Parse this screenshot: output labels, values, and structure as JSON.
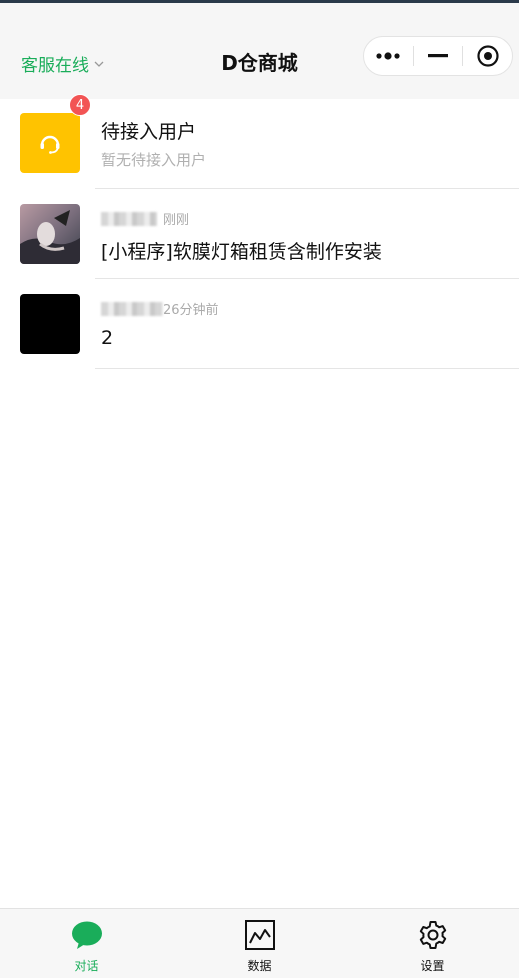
{
  "header": {
    "status_label": "客服在线",
    "title": "D仓商城"
  },
  "capsule": {
    "more_icon": "more-dots-icon",
    "minimize_icon": "minimize-icon",
    "close_icon": "target-close-icon"
  },
  "pending": {
    "title": "待接入用户",
    "subtitle": "暂无待接入用户",
    "icon": "headset-icon",
    "color": "#ffc300"
  },
  "conversations": [
    {
      "time": "刚刚",
      "message": "[小程序]软膜灯箱租赁含制作安装",
      "unread": "4"
    },
    {
      "time": "26分钟前",
      "message": "2"
    }
  ],
  "tabs": [
    {
      "label": "对话",
      "icon": "chat-bubble-icon",
      "active": true
    },
    {
      "label": "数据",
      "icon": "chart-icon",
      "active": false
    },
    {
      "label": "设置",
      "icon": "gear-icon",
      "active": false
    }
  ],
  "colors": {
    "accent": "#1aad5a",
    "badge": "#f25454"
  }
}
